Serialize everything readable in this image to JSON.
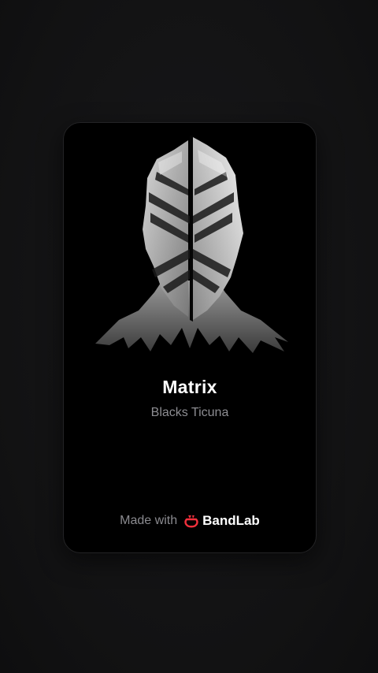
{
  "track": {
    "title": "Matrix",
    "artist": "Blacks Ticuna"
  },
  "footer": {
    "made_with": "Made with",
    "brand": "BandLab",
    "brand_icon": "bandlab-logo-icon"
  },
  "colors": {
    "background": "#121213",
    "card": "#000000",
    "title": "#ffffff",
    "artist": "#8d8d92",
    "brand_accent": "#f0303c"
  }
}
